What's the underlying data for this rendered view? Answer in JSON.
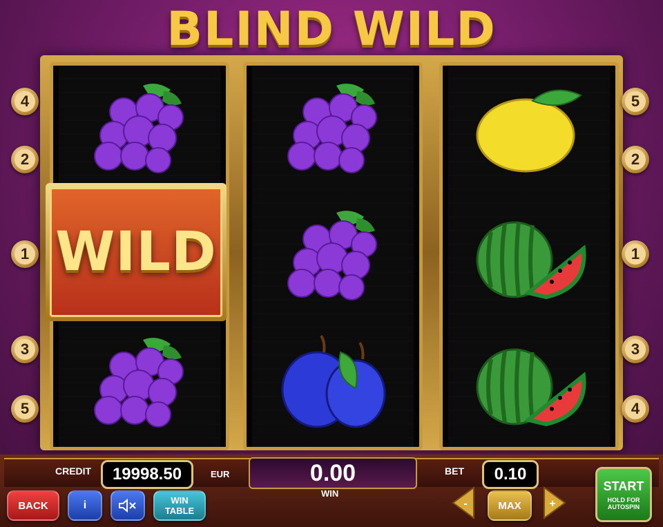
{
  "title": "BLIND WILD",
  "wild_label": "WILD",
  "paylines_left": [
    "4",
    "2",
    "1",
    "3",
    "5"
  ],
  "paylines_right": [
    "5",
    "2",
    "1",
    "3",
    "4"
  ],
  "reels": [
    [
      "grapes",
      "wild",
      "wild",
      "grapes"
    ],
    [
      "grapes",
      "grapes",
      "plum"
    ],
    [
      "lemon",
      "watermelon",
      "watermelon"
    ]
  ],
  "credit": {
    "label": "CREDIT",
    "value": "19998.50",
    "currency": "EUR"
  },
  "win": {
    "value": "0.00",
    "label": "WIN"
  },
  "bet": {
    "label": "BET",
    "value": "0.10"
  },
  "buttons": {
    "back": "BACK",
    "info": "i",
    "sound_icon": "speaker-muted-icon",
    "win_table_line1": "WIN",
    "win_table_line2": "TABLE",
    "minus": "-",
    "max": "MAX",
    "plus": "+",
    "start": "START",
    "start_sub1": "HOLD FOR",
    "start_sub2": "AUTOSPIN"
  }
}
